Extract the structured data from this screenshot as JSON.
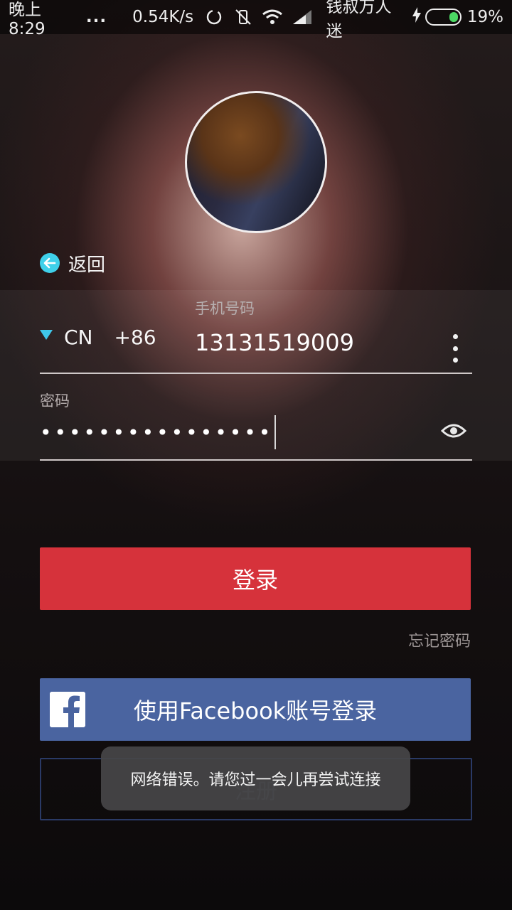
{
  "status_bar": {
    "time": "晚上8:29",
    "dots": "...",
    "net_speed": "0.54K/s",
    "carrier": "钱叔万人迷",
    "battery": "19%"
  },
  "back": {
    "label": "返回"
  },
  "phone": {
    "label": "手机号码",
    "country": "CN",
    "country_code": "+86",
    "value": "13131519009"
  },
  "password": {
    "label": "密码",
    "masked_value": "••••••••••••••••"
  },
  "buttons": {
    "login": "登录",
    "forgot": "忘记密码",
    "facebook": "使用Facebook账号登录",
    "register": "注册"
  },
  "toast": {
    "message": "网络错误。请您过一会儿再尝试连接"
  },
  "colors": {
    "login": "#d6323b",
    "facebook": "#4a64a0",
    "accent": "#3fd0ea"
  }
}
